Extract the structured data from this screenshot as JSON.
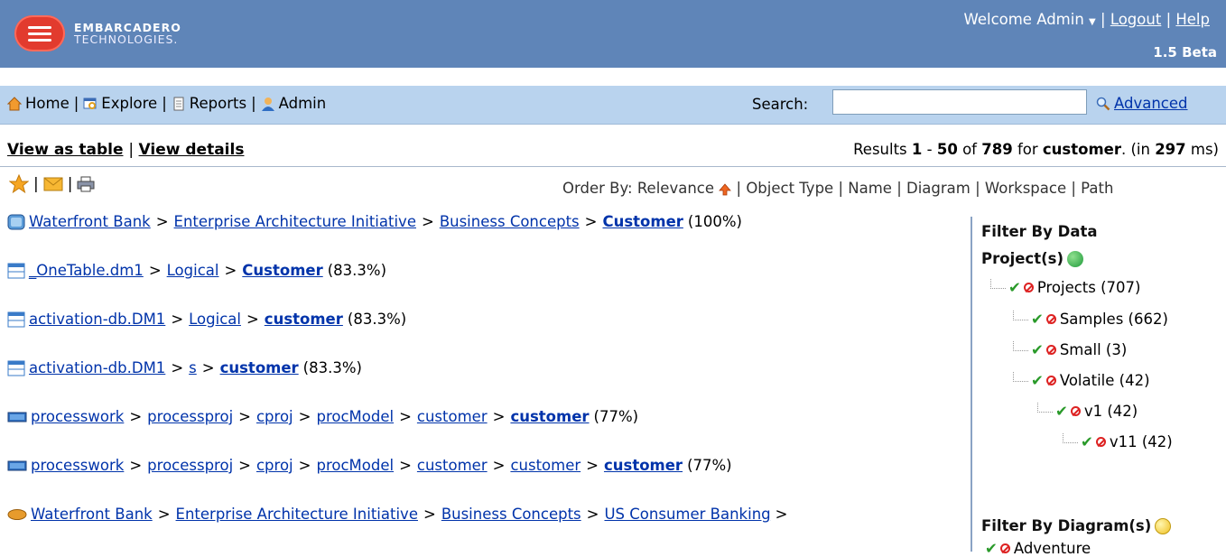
{
  "header": {
    "logo_line1": "EMBARCADERO",
    "logo_line2": "TECHNOLOGIES.",
    "welcome": "Welcome Admin",
    "logout": "Logout",
    "help": "Help",
    "version": "1.5 Beta"
  },
  "nav": {
    "home": "Home",
    "explore": "Explore",
    "reports": "Reports",
    "admin": "Admin",
    "search_label": "Search:",
    "search_value": "",
    "advanced": "Advanced"
  },
  "view": {
    "table": "View as table",
    "details": "View details",
    "results_prefix": "Results",
    "range_start": "1",
    "range_end": "50",
    "of": "of",
    "total": "789",
    "for": "for",
    "query": "customer",
    "in": ". (in",
    "ms": "297",
    "ms_suffix": "ms)"
  },
  "order": {
    "label": "Order By:",
    "relevance": "Relevance",
    "object_type": "Object Type",
    "name": "Name",
    "diagram": "Diagram",
    "workspace": "Workspace",
    "path": "Path"
  },
  "results": [
    {
      "icon": "entity-icon",
      "path": [
        "Waterfront Bank",
        "Enterprise Architecture Initiative",
        "Business Concepts"
      ],
      "target": "Customer",
      "score": "(100%)"
    },
    {
      "icon": "table-icon",
      "path": [
        "_OneTable.dm1",
        "Logical"
      ],
      "target": "Customer",
      "score": "(83.3%)"
    },
    {
      "icon": "table-icon",
      "path": [
        "activation-db.DM1",
        "Logical"
      ],
      "target": "customer",
      "score": "(83.3%)"
    },
    {
      "icon": "table-icon",
      "path": [
        "activation-db.DM1",
        "s"
      ],
      "target": "customer",
      "score": "(83.3%)"
    },
    {
      "icon": "process-icon",
      "path": [
        "processwork",
        "processproj",
        "cproj",
        "procModel",
        "customer"
      ],
      "target": "customer",
      "score": "(77%)"
    },
    {
      "icon": "process-icon",
      "path": [
        "processwork",
        "processproj",
        "cproj",
        "procModel",
        "customer",
        "customer"
      ],
      "target": "customer",
      "score": "(77%)"
    },
    {
      "icon": "concept-icon",
      "path": [
        "Waterfront Bank",
        "Enterprise Architecture Initiative",
        "Business Concepts",
        "US Consumer Banking"
      ],
      "target": "",
      "score": ">"
    }
  ],
  "filter": {
    "by_data": "Filter By Data",
    "projects_label": "Project(s)",
    "tree": [
      {
        "label": "Projects (707)"
      },
      {
        "label": "Samples (662)"
      },
      {
        "label": "Small (3)"
      },
      {
        "label": "Volatile (42)"
      },
      {
        "label": "v1 (42)"
      },
      {
        "label": "v11 (42)"
      }
    ],
    "by_diagram": "Filter By Diagram(s)",
    "diagram_items": [
      {
        "label": "Adventure"
      }
    ]
  }
}
